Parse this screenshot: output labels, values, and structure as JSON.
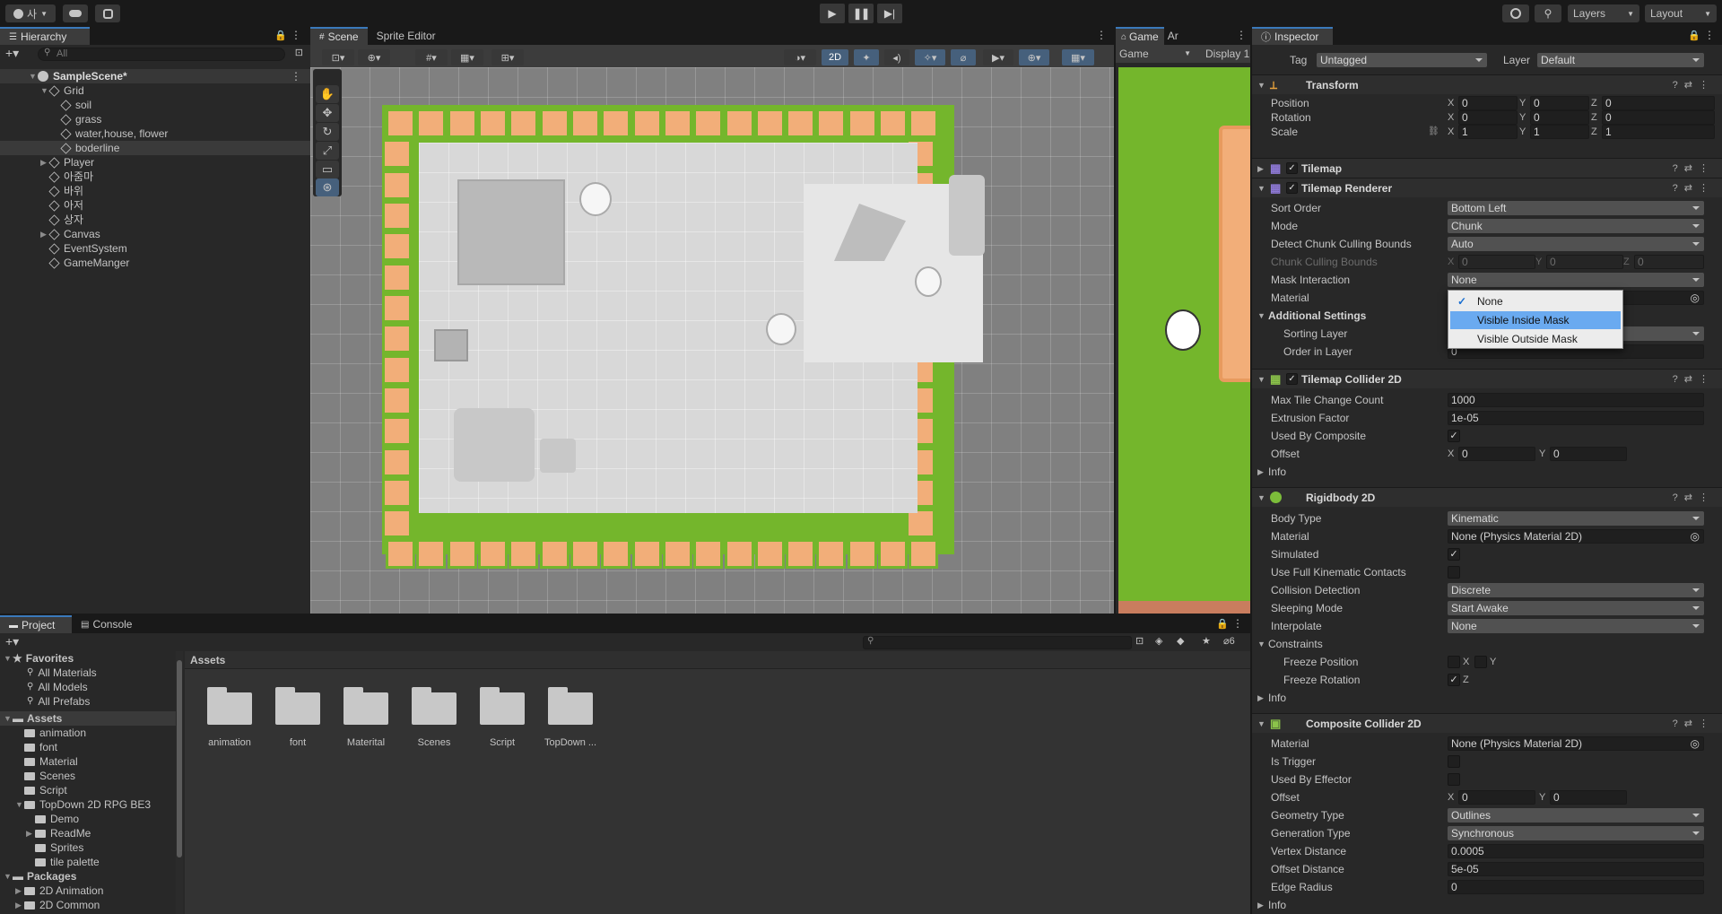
{
  "toolbar": {
    "account_label": "사",
    "layers_label": "Layers",
    "layout_label": "Layout"
  },
  "hierarchy": {
    "tab_label": "Hierarchy",
    "search_placeholder": "All",
    "scene_name": "SampleScene*",
    "items": [
      {
        "label": "Grid",
        "depth": 1,
        "fold": "open"
      },
      {
        "label": "soil",
        "depth": 2,
        "fold": ""
      },
      {
        "label": "grass",
        "depth": 2,
        "fold": ""
      },
      {
        "label": "water,house, flower",
        "depth": 2,
        "fold": ""
      },
      {
        "label": "boderline",
        "depth": 2,
        "fold": "",
        "selected": true
      },
      {
        "label": "Player",
        "depth": 1,
        "fold": "closed"
      },
      {
        "label": "아줌마",
        "depth": 1,
        "fold": ""
      },
      {
        "label": "바위",
        "depth": 1,
        "fold": ""
      },
      {
        "label": "아저",
        "depth": 1,
        "fold": ""
      },
      {
        "label": "상자",
        "depth": 1,
        "fold": ""
      },
      {
        "label": "Canvas",
        "depth": 1,
        "fold": "closed"
      },
      {
        "label": "EventSystem",
        "depth": 1,
        "fold": ""
      },
      {
        "label": "GameManger",
        "depth": 1,
        "fold": ""
      }
    ]
  },
  "scene": {
    "tabs": [
      "Scene",
      "Sprite Editor"
    ],
    "mode_2d_label": "2D"
  },
  "game": {
    "tab_label": "Game",
    "tab2_label": "Ar",
    "view_dropdown": "Game",
    "display_label": "Display 1"
  },
  "inspector": {
    "tab_label": "Inspector",
    "tag_label": "Tag",
    "tag_value": "Untagged",
    "layer_label": "Layer",
    "layer_value": "Default",
    "transform": {
      "title": "Transform",
      "rows": [
        {
          "label": "Position",
          "x": "0",
          "y": "0",
          "z": "0"
        },
        {
          "label": "Rotation",
          "x": "0",
          "y": "0",
          "z": "0"
        },
        {
          "label": "Scale",
          "x": "1",
          "y": "1",
          "z": "1"
        }
      ]
    },
    "tilemap_title": "Tilemap",
    "renderer": {
      "title": "Tilemap Renderer",
      "sort_order_label": "Sort Order",
      "sort_order_value": "Bottom Left",
      "mode_label": "Mode",
      "mode_value": "Chunk",
      "detect_label": "Detect Chunk Culling Bounds",
      "detect_value": "Auto",
      "chunk_bounds_label": "Chunk Culling Bounds",
      "chunk_bounds": {
        "x": "0",
        "y": "0",
        "z": "0"
      },
      "mask_label": "Mask Interaction",
      "mask_value": "None",
      "material_label": "Material",
      "additional_label": "Additional Settings",
      "sorting_layer_label": "Sorting Layer",
      "order_label": "Order in Layer",
      "order_value": "0"
    },
    "mask_dropdown": {
      "options": [
        "None",
        "Visible Inside Mask",
        "Visible Outside Mask"
      ],
      "checked": "None",
      "highlighted": "Visible Inside Mask"
    },
    "collider": {
      "title": "Tilemap Collider 2D",
      "max_label": "Max Tile Change Count",
      "max_value": "1000",
      "extrusion_label": "Extrusion Factor",
      "extrusion_value": "1e-05",
      "used_label": "Used By Composite",
      "offset_label": "Offset",
      "offset": {
        "x": "0",
        "y": "0"
      },
      "info_label": "Info"
    },
    "rigidbody": {
      "title": "Rigidbody 2D",
      "body_type_label": "Body Type",
      "body_type_value": "Kinematic",
      "material_label": "Material",
      "material_value": "None (Physics Material 2D)",
      "simulated_label": "Simulated",
      "full_kin_label": "Use Full Kinematic Contacts",
      "collision_label": "Collision Detection",
      "collision_value": "Discrete",
      "sleeping_label": "Sleeping Mode",
      "sleeping_value": "Start Awake",
      "interp_label": "Interpolate",
      "interp_value": "None",
      "constraints_label": "Constraints",
      "freeze_pos_label": "Freeze Position",
      "freeze_rot_label": "Freeze Rotation",
      "x_label": "X",
      "y_label": "Y",
      "z_label": "Z",
      "info_label": "Info"
    },
    "composite": {
      "title": "Composite Collider 2D",
      "material_label": "Material",
      "material_value": "None (Physics Material 2D)",
      "trigger_label": "Is Trigger",
      "effector_label": "Used By Effector",
      "offset_label": "Offset",
      "offset": {
        "x": "0",
        "y": "0"
      },
      "geometry_label": "Geometry Type",
      "geometry_value": "Outlines",
      "generation_label": "Generation Type",
      "generation_value": "Synchronous",
      "vertex_label": "Vertex Distance",
      "vertex_value": "0.0005",
      "offset_dist_label": "Offset Distance",
      "offset_dist_value": "5e-05",
      "edge_label": "Edge Radius",
      "edge_value": "0",
      "info_label": "Info"
    }
  },
  "project": {
    "tab_label": "Project",
    "console_label": "Console",
    "hidden_count": "6",
    "favorites_label": "Favorites",
    "favorites": [
      "All Materials",
      "All Models",
      "All Prefabs"
    ],
    "assets_label": "Assets",
    "asset_tree": [
      {
        "label": "animation",
        "depth": 1,
        "fold": ""
      },
      {
        "label": "font",
        "depth": 1,
        "fold": ""
      },
      {
        "label": "Material",
        "depth": 1,
        "fold": ""
      },
      {
        "label": "Scenes",
        "depth": 1,
        "fold": ""
      },
      {
        "label": "Script",
        "depth": 1,
        "fold": ""
      },
      {
        "label": "TopDown 2D RPG BE3",
        "depth": 1,
        "fold": "open"
      },
      {
        "label": "Demo",
        "depth": 2,
        "fold": ""
      },
      {
        "label": "ReadMe",
        "depth": 2,
        "fold": "closed"
      },
      {
        "label": "Sprites",
        "depth": 2,
        "fold": ""
      },
      {
        "label": "tile palette",
        "depth": 2,
        "fold": ""
      }
    ],
    "packages_label": "Packages",
    "packages": [
      "2D Animation",
      "2D Common"
    ],
    "breadcrumb": "Assets",
    "folders": [
      "animation",
      "font",
      "Materital",
      "Scenes",
      "Script",
      "TopDown ..."
    ]
  }
}
